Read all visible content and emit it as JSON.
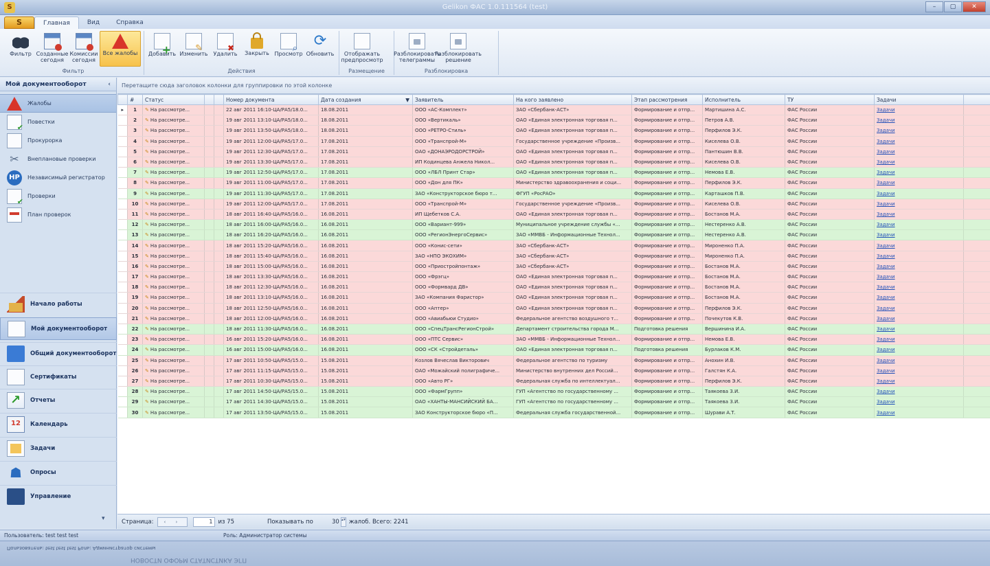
{
  "window": {
    "title": "Gelikon ФАС 1.0.111564 (test)",
    "app_logo": "S",
    "minimize": "–",
    "maximize": "▢",
    "close": "✕"
  },
  "ribbon_tabs": [
    {
      "label": "Главная",
      "active": true
    },
    {
      "label": "Вид",
      "active": false
    },
    {
      "label": "Справка",
      "active": false
    }
  ],
  "ribbon_groups": [
    {
      "label": "Фильтр",
      "buttons": [
        {
          "label": "Фильтр",
          "icon": "binoculars-icon"
        },
        {
          "label": "Созданные сегодня",
          "icon": "calendar-new-icon"
        },
        {
          "label": "Комиссии сегодня",
          "icon": "calendar-icon"
        },
        {
          "label": "Все жалобы",
          "icon": "warning-icon",
          "active": true
        }
      ]
    },
    {
      "label": "Действия",
      "buttons": [
        {
          "label": "Добавить",
          "icon": "add-doc-icon"
        },
        {
          "label": "Изменить",
          "icon": "edit-doc-icon"
        },
        {
          "label": "Удалить",
          "icon": "delete-doc-icon"
        },
        {
          "label": "Закрыть",
          "icon": "lock-icon"
        },
        {
          "label": "Просмотр",
          "icon": "view-doc-icon"
        },
        {
          "label": "Обновить",
          "icon": "refresh-icon"
        }
      ]
    },
    {
      "label": "Размещение",
      "buttons": [
        {
          "label": "Отображать предпросмотр",
          "icon": "preview-icon"
        }
      ]
    },
    {
      "label": "Разблокировка",
      "buttons": [
        {
          "label": "Разблокировать телеграммы",
          "icon": "unlock-telegram-icon"
        },
        {
          "label": "Разблокировать решение",
          "icon": "unlock-decision-icon"
        }
      ]
    }
  ],
  "left_nav": {
    "header": "Мой документооборот",
    "pin": "‹",
    "items": [
      {
        "label": "Жалобы",
        "icon": "complaint-icon",
        "active": true
      },
      {
        "label": "Повестки",
        "icon": "agenda-icon"
      },
      {
        "label": "Прокурорка",
        "icon": "prosecutor-icon"
      },
      {
        "label": "Внеплановые проверки",
        "icon": "tools-icon"
      },
      {
        "label": "Независимый регистратор",
        "icon": "hp-icon"
      },
      {
        "label": "Проверки",
        "icon": "inspection-icon"
      },
      {
        "label": "План проверок",
        "icon": "plan-icon"
      }
    ],
    "sections": [
      {
        "label": "Начало работы",
        "icon": "house-icon"
      },
      {
        "label": "Мой документооборот",
        "icon": "document-icon",
        "active": true
      },
      {
        "label": "Общий документооборот",
        "icon": "folder-icon"
      },
      {
        "label": "Сертификаты",
        "icon": "certificate-icon"
      },
      {
        "label": "Отчеты",
        "icon": "chart-icon"
      },
      {
        "label": "Календарь",
        "icon": "calendar-icon"
      },
      {
        "label": "Задачи",
        "icon": "task-icon"
      },
      {
        "label": "Опросы",
        "icon": "people-icon"
      },
      {
        "label": "Управление",
        "icon": "admin-icon"
      }
    ],
    "expand": "▾"
  },
  "grid": {
    "group_hint": "Перетащите сюда заголовок колонки для группировки по этой колонке",
    "columns": [
      "#",
      "Статус",
      "",
      "",
      "Номер документа",
      "Дата создания",
      "Заявитель",
      "На кого заявлено",
      "Этап рассмотрения",
      "Исполнитель",
      "ТУ",
      "Задачи",
      ""
    ],
    "rows": [
      {
        "n": "1",
        "status": "На рассмотре...",
        "docnum": "22 авг 2011 16:10-ЦА/РА5/18.0...",
        "date": "18.08.2011",
        "applicant": "ООО «АС-Комплект»",
        "respondent": "ЗАО «Сбербанк-АСТ»",
        "stage": "Формирование и отпр...",
        "executor": "Мартишина А.С.",
        "tu": "ФАС России",
        "tasks": "Задачи",
        "color": "red",
        "selected": true
      },
      {
        "n": "2",
        "status": "На рассмотре...",
        "docnum": "19 авг 2011 13:10-ЦА/РА5/18.0...",
        "date": "18.08.2011",
        "applicant": "ООО «Вертикаль»",
        "respondent": "ОАО «Единая электронная торговая п...",
        "stage": "Формирование и отпр...",
        "executor": "Петров А.В.",
        "tu": "ФАС России",
        "tasks": "Задачи",
        "color": "red"
      },
      {
        "n": "3",
        "status": "На рассмотре...",
        "docnum": "19 авг 2011 13:50-ЦА/РА5/18.0...",
        "date": "18.08.2011",
        "applicant": "ООО «РЕТРО-Стиль»",
        "respondent": "ОАО «Единая электронная торговая п...",
        "stage": "Формирование и отпр...",
        "executor": "Перфилов Э.К.",
        "tu": "ФАС России",
        "tasks": "Задачи",
        "color": "red"
      },
      {
        "n": "4",
        "status": "На рассмотре...",
        "docnum": "19 авг 2011 12:00-ЦА/РА5/17.0...",
        "date": "17.08.2011",
        "applicant": "ООО «Транспрой-М»",
        "respondent": "Государственное учреждение «Произв...",
        "stage": "Формирование и отпр...",
        "executor": "Киселева О.В.",
        "tu": "ФАС России",
        "tasks": "Задачи",
        "color": "red"
      },
      {
        "n": "5",
        "status": "На рассмотре...",
        "docnum": "19 авг 2011 12:30-ЦА/РА5/17.0...",
        "date": "17.08.2011",
        "applicant": "ОАО «ДОНАЭРОДОРСТРОЙ»",
        "respondent": "ОАО «Единая электронная торговая п...",
        "stage": "Формирование и отпр...",
        "executor": "Пантюшин В.В.",
        "tu": "ФАС России",
        "tasks": "Задачи",
        "color": "red"
      },
      {
        "n": "6",
        "status": "На рассмотре...",
        "docnum": "19 авг 2011 13:30-ЦА/РА5/17.0...",
        "date": "17.08.2011",
        "applicant": "ИП Кодинцева Анжела Никол...",
        "respondent": "ОАО «Единая электронная торговая п...",
        "stage": "Формирование и отпр...",
        "executor": "Киселева О.В.",
        "tu": "ФАС России",
        "tasks": "Задачи",
        "color": "red"
      },
      {
        "n": "7",
        "status": "На рассмотре...",
        "docnum": "19 авг 2011 12:50-ЦА/РА5/17.0...",
        "date": "17.08.2011",
        "applicant": "ООО «ЛБЛ Принт Стар»",
        "respondent": "ОАО «Единая электронная торговая п...",
        "stage": "Формирование и отпр...",
        "executor": "Немова Е.В.",
        "tu": "ФАС России",
        "tasks": "Задачи",
        "color": "green"
      },
      {
        "n": "8",
        "status": "На рассмотре...",
        "docnum": "19 авг 2011 11:00-ЦА/РА5/17.0...",
        "date": "17.08.2011",
        "applicant": "ООО «Дон для ПК»",
        "respondent": "Министерство здравоохранения и соци...",
        "stage": "Формирование и отпр...",
        "executor": "Перфилов Э.К.",
        "tu": "ФАС России",
        "tasks": "Задачи",
        "color": "red"
      },
      {
        "n": "9",
        "status": "На рассмотре...",
        "docnum": "19 авг 2011 11:30-ЦА/РА5/17.0...",
        "date": "17.08.2011",
        "applicant": "ЗАО «Конструкторское бюро т...",
        "respondent": "ФГУП «РосРАО»",
        "stage": "Формирование и отпр...",
        "executor": "Карташков П.В.",
        "tu": "ФАС России",
        "tasks": "Задачи",
        "color": "green"
      },
      {
        "n": "10",
        "status": "На рассмотре...",
        "docnum": "19 авг 2011 12:00-ЦА/РА5/17.0...",
        "date": "17.08.2011",
        "applicant": "ООО «Транспрой-М»",
        "respondent": "Государственное учреждение «Произв...",
        "stage": "Формирование и отпр...",
        "executor": "Киселева О.В.",
        "tu": "ФАС России",
        "tasks": "Задачи",
        "color": "red"
      },
      {
        "n": "11",
        "status": "На рассмотре...",
        "docnum": "18 авг 2011 16:40-ЦА/РА5/16.0...",
        "date": "16.08.2011",
        "applicant": "ИП Щебетков С.А.",
        "respondent": "ОАО «Единая электронная торговая п...",
        "stage": "Формирование и отпр...",
        "executor": "Бостанов М.А.",
        "tu": "ФАС России",
        "tasks": "Задачи",
        "color": "red"
      },
      {
        "n": "12",
        "status": "На рассмотре...",
        "docnum": "18 авг 2011 16:00-ЦА/РА5/16.0...",
        "date": "16.08.2011",
        "applicant": "ООО «Вариант-999»",
        "respondent": "Муниципальное учреждение службы «...",
        "stage": "Формирование и отпр...",
        "executor": "Нестеренко А.В.",
        "tu": "ФАС России",
        "tasks": "Задачи",
        "color": "green"
      },
      {
        "n": "13",
        "status": "На рассмотре...",
        "docnum": "18 авг 2011 16:20-ЦА/РА5/16.0...",
        "date": "16.08.2011",
        "applicant": "ООО «РегионЭнергоСервис»",
        "respondent": "ЗАО «ММВБ - Информационные Технол...",
        "stage": "Формирование и отпр...",
        "executor": "Нестеренко А.В.",
        "tu": "ФАС России",
        "tasks": "Задачи",
        "color": "green"
      },
      {
        "n": "14",
        "status": "На рассмотре...",
        "docnum": "18 авг 2011 15:20-ЦА/РА5/16.0...",
        "date": "16.08.2011",
        "applicant": "ООО «Конис-сети»",
        "respondent": "ЗАО «Сбербанк-АСТ»",
        "stage": "Формирование и отпр...",
        "executor": "Мироненко П.А.",
        "tu": "ФАС России",
        "tasks": "Задачи",
        "color": "red"
      },
      {
        "n": "15",
        "status": "На рассмотре...",
        "docnum": "18 авг 2011 15:40-ЦА/РА5/16.0...",
        "date": "16.08.2011",
        "applicant": "ЗАО «НПО ЭКОХИМ»",
        "respondent": "ЗАО «Сбербанк-АСТ»",
        "stage": "Формирование и отпр...",
        "executor": "Мироненко П.А.",
        "tu": "ФАС России",
        "tasks": "Задачи",
        "color": "red"
      },
      {
        "n": "16",
        "status": "На рассмотре...",
        "docnum": "18 авг 2011 15:00-ЦА/РА5/16.0...",
        "date": "16.08.2011",
        "applicant": "ООО «Приостройпонтаж»",
        "respondent": "ЗАО «Сбербанк-АСТ»",
        "stage": "Формирование и отпр...",
        "executor": "Бостанов М.А.",
        "tu": "ФАС России",
        "tasks": "Задачи",
        "color": "red"
      },
      {
        "n": "17",
        "status": "На рассмотре...",
        "docnum": "18 авг 2011 13:30-ЦА/РА5/16.0...",
        "date": "16.08.2011",
        "applicant": "ООО «Фрэгц»",
        "respondent": "ОАО «Единая электронная торговая п...",
        "stage": "Формирование и отпр...",
        "executor": "Бостанов М.А.",
        "tu": "ФАС России",
        "tasks": "Задачи",
        "color": "red"
      },
      {
        "n": "18",
        "status": "На рассмотре...",
        "docnum": "18 авг 2011 12:30-ЦА/РА5/16.0...",
        "date": "16.08.2011",
        "applicant": "ООО «Формвард ДВ»",
        "respondent": "ОАО «Единая электронная торговая п...",
        "stage": "Формирование и отпр...",
        "executor": "Бостанов М.А.",
        "tu": "ФАС России",
        "tasks": "Задачи",
        "color": "red"
      },
      {
        "n": "19",
        "status": "На рассмотре...",
        "docnum": "18 авг 2011 13:10-ЦА/РА5/16.0...",
        "date": "16.08.2011",
        "applicant": "ЗАО «Компания Фаристор»",
        "respondent": "ОАО «Единая электронная торговая п...",
        "stage": "Формирование и отпр...",
        "executor": "Бостанов М.А.",
        "tu": "ФАС России",
        "tasks": "Задачи",
        "color": "red"
      },
      {
        "n": "20",
        "status": "На рассмотре...",
        "docnum": "18 авг 2011 12:50-ЦА/РА5/16.0...",
        "date": "16.08.2011",
        "applicant": "ООО «Аптер»",
        "respondent": "ОАО «Единая электронная торговая п...",
        "stage": "Формирование и отпр...",
        "executor": "Перфилов Э.К.",
        "tu": "ФАС России",
        "tasks": "Задачи",
        "color": "red"
      },
      {
        "n": "21",
        "status": "На рассмотре...",
        "docnum": "18 авг 2011 12:00-ЦА/РА5/16.0...",
        "date": "16.08.2011",
        "applicant": "ООО «Авиабьюи Студио»",
        "respondent": "Федеральное агентство воздушного т...",
        "stage": "Формирование и отпр...",
        "executor": "Почекутов К.В.",
        "tu": "ФАС России",
        "tasks": "Задачи",
        "color": "red"
      },
      {
        "n": "22",
        "status": "На рассмотре...",
        "docnum": "18 авг 2011 11:30-ЦА/РА5/16.0...",
        "date": "16.08.2011",
        "applicant": "ООО «СпецТрансРегионСтрой»",
        "respondent": "Департамент строительства города М...",
        "stage": "Подготовка решения",
        "executor": "Вершинина И.А.",
        "tu": "ФАС России",
        "tasks": "Задачи",
        "color": "green"
      },
      {
        "n": "23",
        "status": "На рассмотре...",
        "docnum": "16 авг 2011 15:20-ЦА/РА5/16.0...",
        "date": "16.08.2011",
        "applicant": "ООО «ПТС Сервис»",
        "respondent": "ЗАО «ММВБ - Информационные Технол...",
        "stage": "Формирование и отпр...",
        "executor": "Немова Е.В.",
        "tu": "ФАС России",
        "tasks": "Задачи",
        "color": "red"
      },
      {
        "n": "24",
        "status": "На рассмотре...",
        "docnum": "16 авг 2011 15:00-ЦА/РА5/16.0...",
        "date": "16.08.2011",
        "applicant": "ООО «СК «Стройдеталь»",
        "respondent": "ОАО «Единая электронная торговая п...",
        "stage": "Подготовка решения",
        "executor": "Бурлаков К.М.",
        "tu": "ФАС России",
        "tasks": "Задачи",
        "color": "green"
      },
      {
        "n": "25",
        "status": "На рассмотре...",
        "docnum": "17 авг 2011 10:50-ЦА/РА5/15.0...",
        "date": "15.08.2011",
        "applicant": "Козлов Вячеслав Викторович",
        "respondent": "Федеральное агентство по туризму",
        "stage": "Формирование и отпр...",
        "executor": "Анохин И.В.",
        "tu": "ФАС России",
        "tasks": "Задачи",
        "color": "red"
      },
      {
        "n": "26",
        "status": "На рассмотре...",
        "docnum": "17 авг 2011 11:15-ЦА/РА5/15.0...",
        "date": "15.08.2011",
        "applicant": "ОАО «Можайский полиграфиче...",
        "respondent": "Министерство внутренних дел Россий...",
        "stage": "Формирование и отпр...",
        "executor": "Галстян К.А.",
        "tu": "ФАС России",
        "tasks": "Задачи",
        "color": "red"
      },
      {
        "n": "27",
        "status": "На рассмотре...",
        "docnum": "17 авг 2011 10:30-ЦА/РА5/15.0...",
        "date": "15.08.2011",
        "applicant": "ООО «Авто РГ»",
        "respondent": "Федеральная служба по интеллектуал...",
        "stage": "Формирование и отпр...",
        "executor": "Перфилов Э.К.",
        "tu": "ФАС России",
        "tasks": "Задачи",
        "color": "red"
      },
      {
        "n": "28",
        "status": "На рассмотре...",
        "docnum": "17 авг 2011 14:50-ЦА/РА5/15.0...",
        "date": "15.08.2011",
        "applicant": "ООО «ФармГрупп»",
        "respondent": "ГУП «Агентство по государственному ...",
        "stage": "Формирование и отпр...",
        "executor": "Таякоева З.И.",
        "tu": "ФАС России",
        "tasks": "Задачи",
        "color": "green"
      },
      {
        "n": "29",
        "status": "На рассмотре...",
        "docnum": "17 авг 2011 14:30-ЦА/РА5/15.0...",
        "date": "15.08.2011",
        "applicant": "ОАО «ХАНТЫ-МАНСИЙСКИЙ БА...",
        "respondent": "ГУП «Агентство по государственному ...",
        "stage": "Формирование и отпр...",
        "executor": "Таякоева З.И.",
        "tu": "ФАС России",
        "tasks": "Задачи",
        "color": "green"
      },
      {
        "n": "30",
        "status": "На рассмотре...",
        "docnum": "17 авг 2011 13:50-ЦА/РА5/15.0...",
        "date": "15.08.2011",
        "applicant": "ЗАО Конструкторское бюро «П...",
        "respondent": "Федеральная служба государственной...",
        "stage": "Формирование и отпр...",
        "executor": "Шурави А.Т.",
        "tu": "ФАС России",
        "tasks": "Задачи",
        "color": "green"
      }
    ]
  },
  "pager": {
    "page_label": "Страница:",
    "nav": "‹ ›",
    "current_page": "1",
    "of_label": "из 75",
    "show_label": "Показывать по",
    "per_page": "30",
    "spin": "▴▾",
    "total": "жалоб. Всего: 2241"
  },
  "status": {
    "user": "Пользователь: test test test",
    "role": "Роль: Администратор системы"
  },
  "footer": {
    "mirror_text": "Пользователь: test test test    Роль: Администратор системы",
    "mirror_text2": "НОВОСТИ                                   ОФОРМ СТАТИСТИКА ЭГП"
  }
}
